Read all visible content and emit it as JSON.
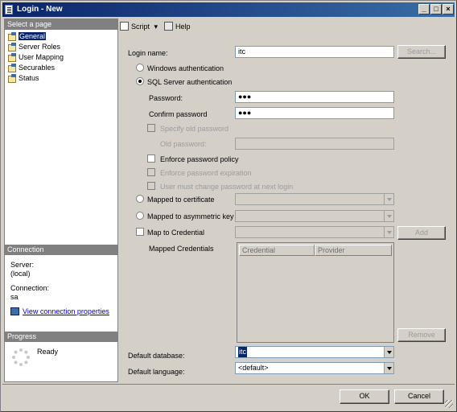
{
  "window": {
    "title": "Login - New",
    "minimize": "_",
    "maximize": "□",
    "close": "×"
  },
  "left_pane": {
    "select_page_header": "Select a page",
    "pages": [
      {
        "label": "General",
        "selected": true
      },
      {
        "label": "Server Roles",
        "selected": false
      },
      {
        "label": "User Mapping",
        "selected": false
      },
      {
        "label": "Securables",
        "selected": false
      },
      {
        "label": "Status",
        "selected": false
      }
    ],
    "connection_header": "Connection",
    "server_label": "Server:",
    "server_value": "(local)",
    "connection_label": "Connection:",
    "connection_value": "sa",
    "view_connection_link": "View connection properties",
    "progress_header": "Progress",
    "progress_status": "Ready"
  },
  "toolbar": {
    "script_label": "Script",
    "help_label": "Help"
  },
  "form": {
    "login_name_label": "Login name:",
    "login_name_value": "itc",
    "search_button": "Search...",
    "windows_auth_label": "Windows authentication",
    "sql_auth_label": "SQL Server authentication",
    "password_label": "Password:",
    "password_value": "●●●",
    "confirm_password_label": "Confirm password",
    "confirm_password_value": "●●●",
    "specify_old_password_label": "Specify old password",
    "old_password_label": "Old password:",
    "enforce_policy_label": "Enforce password policy",
    "enforce_expiration_label": "Enforce password expiration",
    "must_change_label": "User must change password at next login",
    "mapped_certificate_label": "Mapped to certificate",
    "mapped_asymmetric_label": "Mapped to asymmetric key",
    "map_credential_label": "Map to Credential",
    "add_button": "Add",
    "mapped_credentials_label": "Mapped Credentials",
    "credential_col": "Credential",
    "provider_col": "Provider",
    "remove_button": "Remove",
    "default_database_label": "Default database:",
    "default_database_value": "itc",
    "default_language_label": "Default language:",
    "default_language_value": "<default>"
  },
  "footer": {
    "ok_button": "OK",
    "cancel_button": "Cancel"
  },
  "colors": {
    "titlebar": "#0a246a",
    "selection": "#0a246a",
    "section_header": "#808080",
    "chrome": "#d4d0c8",
    "link": "#0000cc"
  }
}
